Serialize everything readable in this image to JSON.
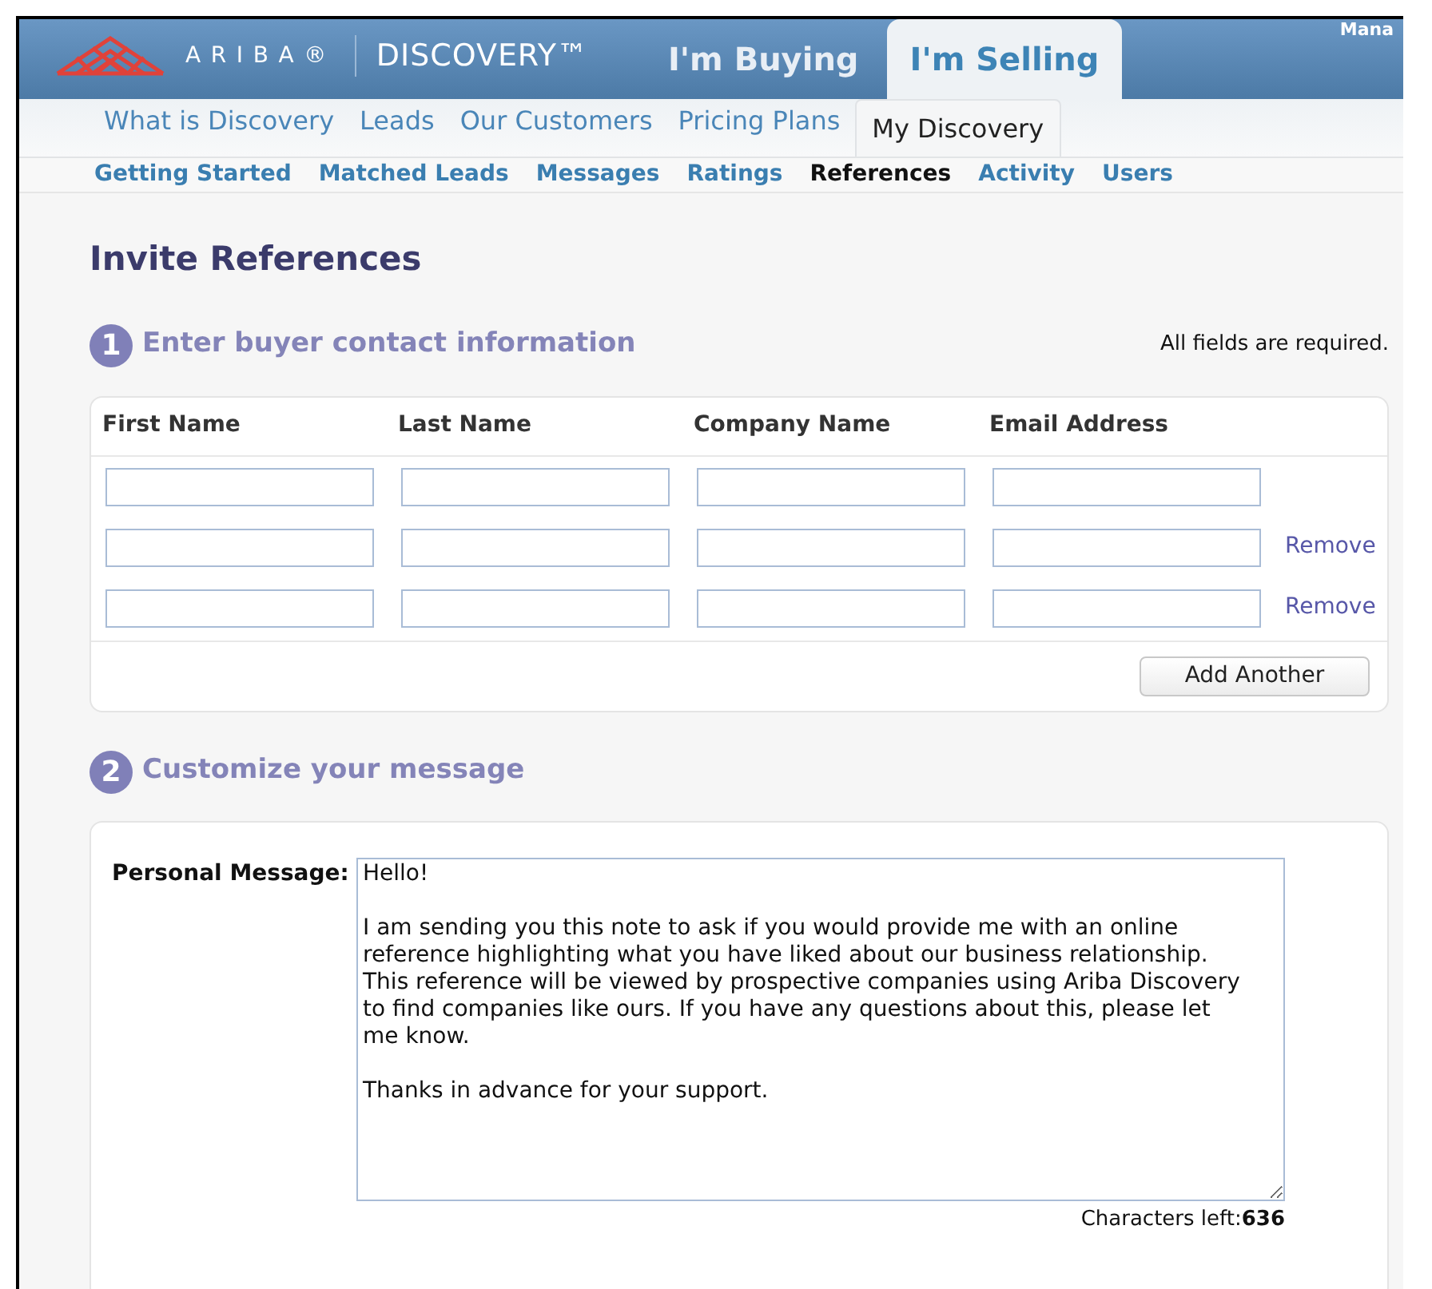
{
  "header": {
    "brand": "ARIBA®",
    "product": "DISCOVERY™",
    "corner_text": "Mana",
    "tabs": [
      {
        "label": "I'm Buying",
        "selected": false
      },
      {
        "label": "I'm Selling",
        "selected": true
      }
    ]
  },
  "nav": [
    {
      "label": "What is Discovery",
      "selected": false
    },
    {
      "label": "Leads",
      "selected": false
    },
    {
      "label": "Our Customers",
      "selected": false
    },
    {
      "label": "Pricing Plans",
      "selected": false
    },
    {
      "label": "My Discovery",
      "selected": true
    }
  ],
  "subnav": [
    {
      "label": "Getting Started",
      "selected": false
    },
    {
      "label": "Matched Leads",
      "selected": false
    },
    {
      "label": "Messages",
      "selected": false
    },
    {
      "label": "Ratings",
      "selected": false
    },
    {
      "label": "References",
      "selected": true
    },
    {
      "label": "Activity",
      "selected": false
    },
    {
      "label": "Users",
      "selected": false
    }
  ],
  "page_title": "Invite References",
  "step1": {
    "number": "1",
    "title": "Enter buyer contact information",
    "note": "All fields are required.",
    "columns": [
      "First Name",
      "Last Name",
      "Company Name",
      "Email Address"
    ],
    "rows": [
      {},
      {
        "remove": "Remove"
      },
      {
        "remove": "Remove"
      }
    ],
    "add_button": "Add Another"
  },
  "step2": {
    "number": "2",
    "title": "Customize your message",
    "label": "Personal Message:",
    "message": "Hello!\n\nI am sending you this note to ask if you would provide me with an online reference highlighting what you have liked about our business relationship. This reference will be viewed by prospective companies using Ariba Discovery to find companies like ours. If you have any questions about this, please let me know.\n\nThanks in advance for your support.",
    "chars_left": "Characters left:**636**"
  }
}
